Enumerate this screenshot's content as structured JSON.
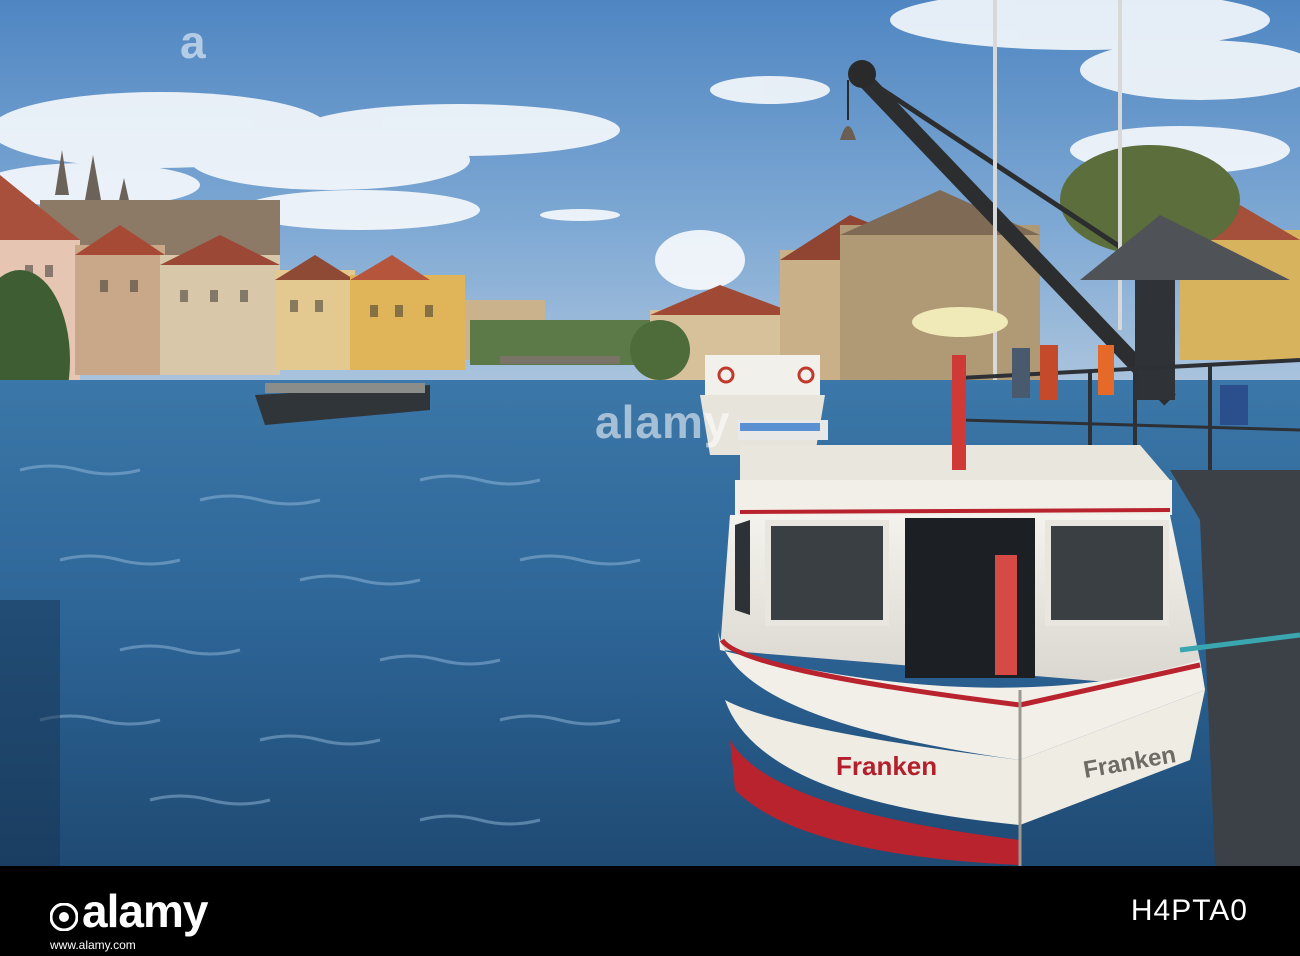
{
  "photo": {
    "description_tag": "stock-photo",
    "boat_name_bow": "Franken",
    "boat_name_side": "Franken"
  },
  "watermark": {
    "logo_text": "alamy",
    "image_id": "H4PTA0",
    "url": "www.alamy.com"
  },
  "colors": {
    "sky": "#5f93c9",
    "water": "#2f6a9c",
    "footer_bg": "#000000",
    "boat_red": "#b8232e",
    "boat_white": "#f2f0ea"
  }
}
